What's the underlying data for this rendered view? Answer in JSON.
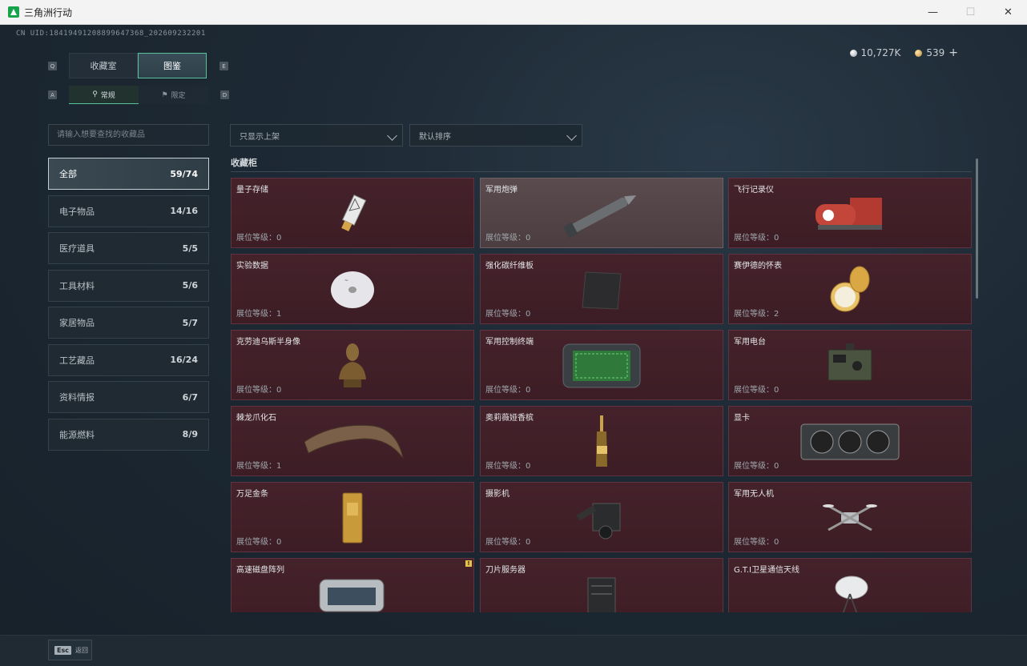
{
  "window": {
    "title": "三角洲行动",
    "minimize": "—",
    "maximize": "☐",
    "close": "✕"
  },
  "uid": "CN UID:184194912088996473​68_202609232201",
  "currency": {
    "silver": "10,727K",
    "gold": "539",
    "add": "+"
  },
  "keys": {
    "tab_left": "Q",
    "tab_right": "E",
    "sub_left": "A",
    "sub_right": "D"
  },
  "main_tabs": [
    {
      "label": "收藏室"
    },
    {
      "label": "图鉴"
    }
  ],
  "sub_tabs": [
    {
      "label": "常规"
    },
    {
      "label": "限定"
    }
  ],
  "search": {
    "placeholder": "请输入想要查找的收藏品"
  },
  "filters": {
    "display": "只显示上架",
    "sort": "默认排序"
  },
  "categories": [
    {
      "label": "全部",
      "count": "59/74"
    },
    {
      "label": "电子物品",
      "count": "14/16"
    },
    {
      "label": "医疗道具",
      "count": "5/5"
    },
    {
      "label": "工具材料",
      "count": "5/6"
    },
    {
      "label": "家居物品",
      "count": "5/7"
    },
    {
      "label": "工艺藏品",
      "count": "16/24"
    },
    {
      "label": "资料情报",
      "count": "6/7"
    },
    {
      "label": "能源燃料",
      "count": "8/9"
    }
  ],
  "section_title": "收藏柜",
  "level_prefix": "展位等级：",
  "items": [
    {
      "name": "量子存储",
      "level": "展位等级：0",
      "icon": "usb-drive-icon"
    },
    {
      "name": "军用炮弹",
      "level": "展位等级：0",
      "icon": "artillery-shell-icon"
    },
    {
      "name": "飞行记录仪",
      "level": "展位等级：0",
      "icon": "flight-recorder-icon"
    },
    {
      "name": "实验数据",
      "level": "展位等级：1",
      "icon": "disc-icon"
    },
    {
      "name": "强化碳纤维板",
      "level": "展位等级：0",
      "icon": "carbon-plate-icon"
    },
    {
      "name": "赛伊德的怀表",
      "level": "展位等级：2",
      "icon": "pocket-watch-icon"
    },
    {
      "name": "克劳迪乌斯半身像",
      "level": "展位等级：0",
      "icon": "bust-icon"
    },
    {
      "name": "军用控制终端",
      "level": "展位等级：0",
      "icon": "control-terminal-icon"
    },
    {
      "name": "军用电台",
      "level": "展位等级：0",
      "icon": "radio-icon"
    },
    {
      "name": "棘龙爪化石",
      "level": "展位等级：1",
      "icon": "claw-fossil-icon"
    },
    {
      "name": "奥莉薇娅香槟",
      "level": "展位等级：0",
      "icon": "champagne-icon"
    },
    {
      "name": "显卡",
      "level": "展位等级：0",
      "icon": "graphics-card-icon"
    },
    {
      "name": "万足金条",
      "level": "展位等级：0",
      "icon": "gold-bar-icon"
    },
    {
      "name": "摄影机",
      "level": "展位等级：0",
      "icon": "camera-icon"
    },
    {
      "name": "军用无人机",
      "level": "展位等级：0",
      "icon": "drone-icon"
    },
    {
      "name": "高速磁盘阵列",
      "level": "",
      "icon": "disk-array-icon",
      "badge": "!"
    },
    {
      "name": "刀片服务器",
      "level": "",
      "icon": "blade-server-icon"
    },
    {
      "name": "G.T.I卫星通信天线",
      "level": "",
      "icon": "satellite-dish-icon"
    }
  ],
  "colors": {
    "accent": "#57c29b",
    "card_bg": "#45222b",
    "card_grey": "#5a4c4e"
  },
  "bottom": {
    "esc_key": "Esc",
    "esc_label": "返回"
  }
}
